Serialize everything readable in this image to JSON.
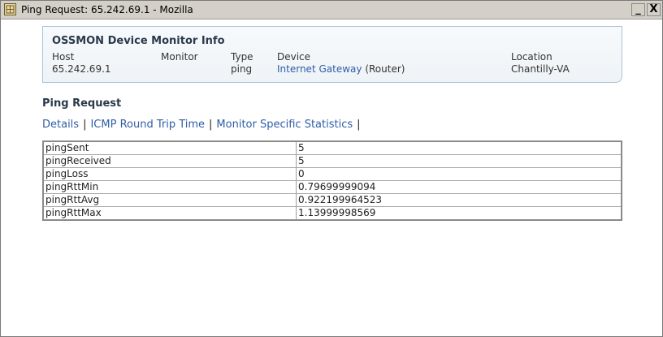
{
  "window": {
    "title": "Ping Request: 65.242.69.1 - Mozilla",
    "minimize_label": "_",
    "close_label": "X"
  },
  "device_info": {
    "title": "OSSMON Device Monitor Info",
    "headers": {
      "host": "Host",
      "monitor": "Monitor",
      "type": "Type",
      "device": "Device",
      "location": "Location"
    },
    "values": {
      "host": "65.242.69.1",
      "monitor": "",
      "type": "ping",
      "device_link": "Internet Gateway",
      "device_suffix": "(Router)",
      "location": "Chantilly-VA"
    }
  },
  "section": {
    "title": "Ping Request"
  },
  "nav": {
    "details": "Details",
    "icmp": "ICMP Round Trip Time",
    "monitor_stats": "Monitor Specific Statistics",
    "sep": "|"
  },
  "stats": [
    {
      "key": "pingSent",
      "value": "5"
    },
    {
      "key": "pingReceived",
      "value": "5"
    },
    {
      "key": "pingLoss",
      "value": "0"
    },
    {
      "key": "pingRttMin",
      "value": "0.79699999094"
    },
    {
      "key": "pingRttAvg",
      "value": "0.922199964523"
    },
    {
      "key": "pingRttMax",
      "value": "1.13999998569"
    }
  ]
}
